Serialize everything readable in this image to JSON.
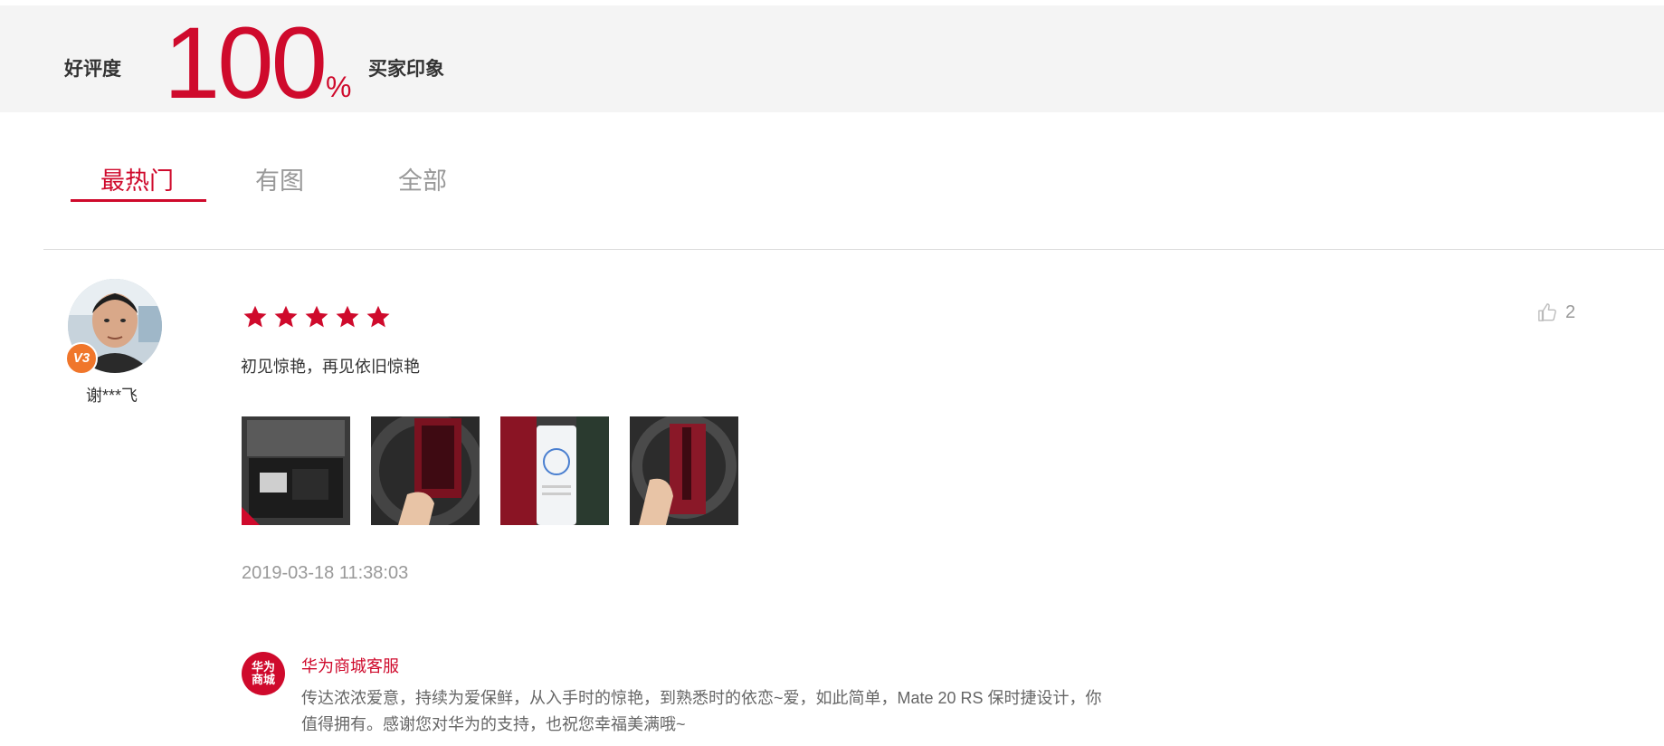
{
  "summary": {
    "rating_label": "好评度",
    "rating_value": "100",
    "rating_unit": "%",
    "impression_label": "买家印象"
  },
  "tabs": [
    {
      "label": "最热门",
      "active": true
    },
    {
      "label": "有图",
      "active": false
    },
    {
      "label": "全部",
      "active": false
    }
  ],
  "review": {
    "username": "谢***飞",
    "vip_badge": "V3",
    "stars": 5,
    "comment": "初见惊艳，再见依旧惊艳",
    "like_count": "2",
    "photo_count": 4,
    "timestamp": "2019-03-18 11:38:03",
    "reply": {
      "logo_text": "华为商城",
      "name": "华为商城客服",
      "text": "传达浓浓爱意，持续为爱保鲜，从入手时的惊艳，到熟悉时的依恋~爱，如此简单，Mate 20 RS 保时捷设计，你值得拥有。感谢您对华为的支持，也祝您幸福美满哦~"
    }
  },
  "colors": {
    "accent": "#cf0a2c",
    "summary_bg": "#f4f4f4",
    "muted_text": "#999999",
    "badge": "#f0762b"
  },
  "icons": {
    "star": "star-icon",
    "like": "thumbs-up-icon"
  }
}
